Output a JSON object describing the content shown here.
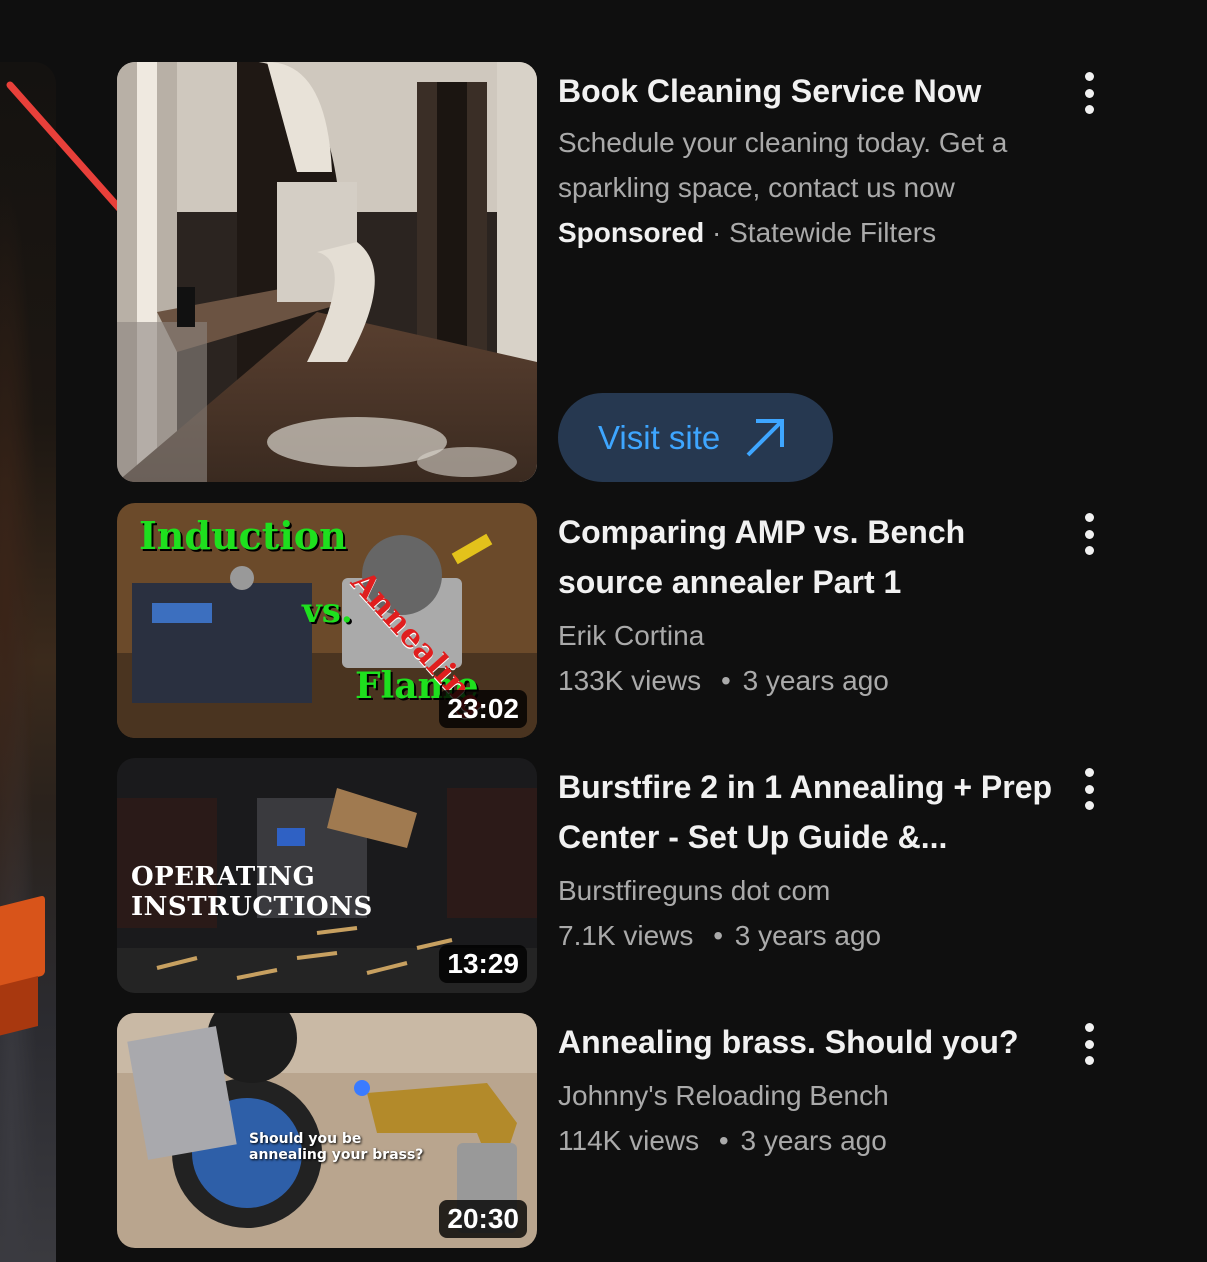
{
  "ad": {
    "title": "Book Cleaning Service Now",
    "description": "Schedule your cleaning today. Get a sparkling space, contact us now",
    "sponsored_label": "Sponsored",
    "advertiser": "Statewide Filters",
    "separator": "·",
    "cta_label": "Visit site",
    "cta_icon": "external-arrow-icon"
  },
  "videos": [
    {
      "title": "Comparing AMP vs. Bench source annealer Part 1",
      "channel": "Erik Cortina",
      "views": "133K views",
      "age": "3 years ago",
      "duration": "23:02",
      "thumb_text": [
        "Induction",
        "vs.",
        "Flame",
        "Annealing"
      ]
    },
    {
      "title": "Burstfire 2 in 1 Annealing + Prep Center - Set Up Guide &...",
      "channel": "Burstfireguns dot com",
      "views": "7.1K views",
      "age": "3 years ago",
      "duration": "13:29",
      "thumb_text": [
        "OPERATING INSTRUCTIONS"
      ]
    },
    {
      "title": "Annealing brass. Should you?",
      "channel": "Johnny's Reloading Bench",
      "views": "114K views",
      "age": "3 years ago",
      "duration": "20:30",
      "thumb_text": [
        "Should you be annealing your brass?"
      ]
    }
  ],
  "meta_separator": "•",
  "colors": {
    "background": "#0f0f0f",
    "cta_bg": "#263850",
    "cta_text": "#3ea6ff",
    "arrow": "#e8403a"
  }
}
